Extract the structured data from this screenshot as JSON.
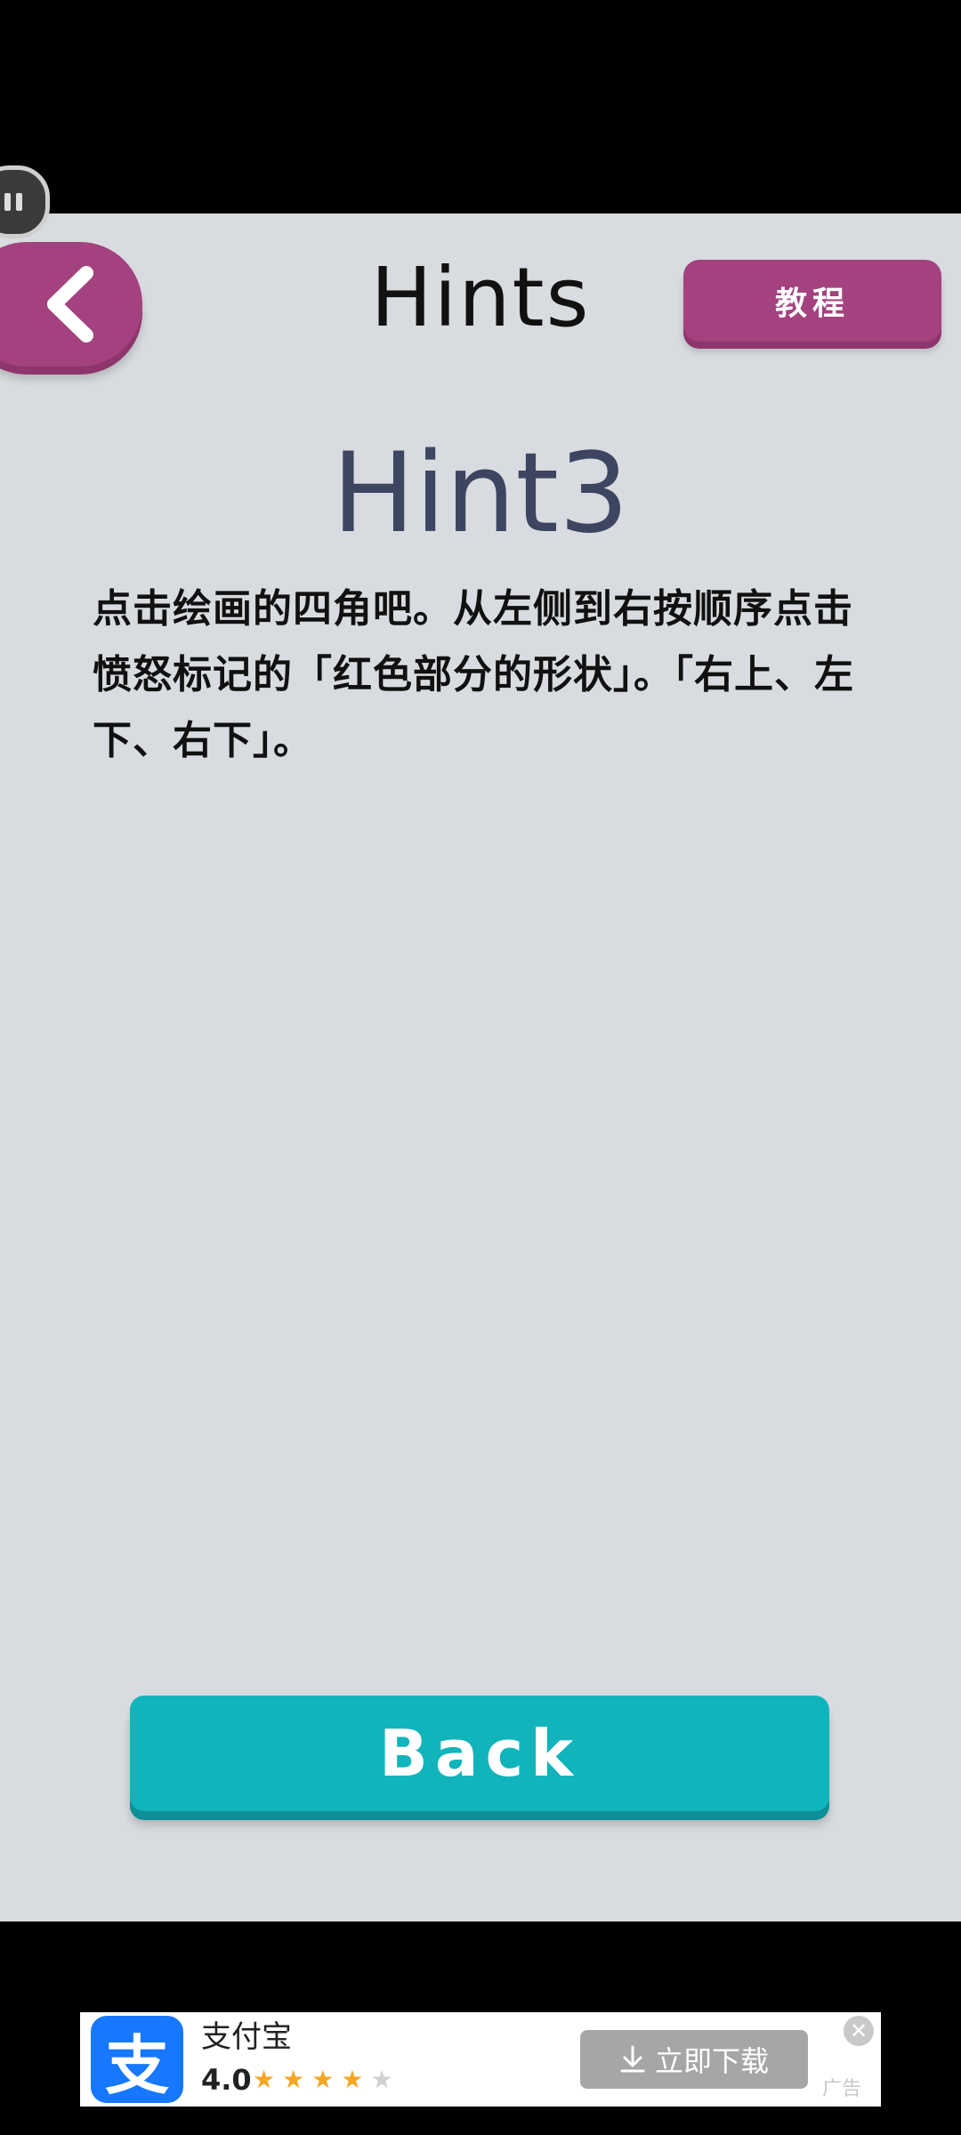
{
  "header": {
    "title": "Hints",
    "tutorial_label": "教程"
  },
  "hint": {
    "heading": "Hint3",
    "body": "点击绘画的四角吧。从左侧到右按顺序点击愤怒标记的「红色部分的形状」。「右上、左下、右下」。"
  },
  "footer": {
    "back_label": "Back"
  },
  "ad": {
    "icon_glyph": "支",
    "app_name": "支付宝",
    "rating": "4.0",
    "stars_filled": 4,
    "stars_total": 5,
    "download_label": "立即下载",
    "close_glyph": "✕",
    "ad_label": "广告"
  },
  "colors": {
    "panel_bg": "#d8dce0",
    "accent_purple": "#a3427f",
    "accent_teal": "#12b4bc",
    "heading_color": "#3d4560",
    "ad_icon_blue": "#1677ff"
  }
}
